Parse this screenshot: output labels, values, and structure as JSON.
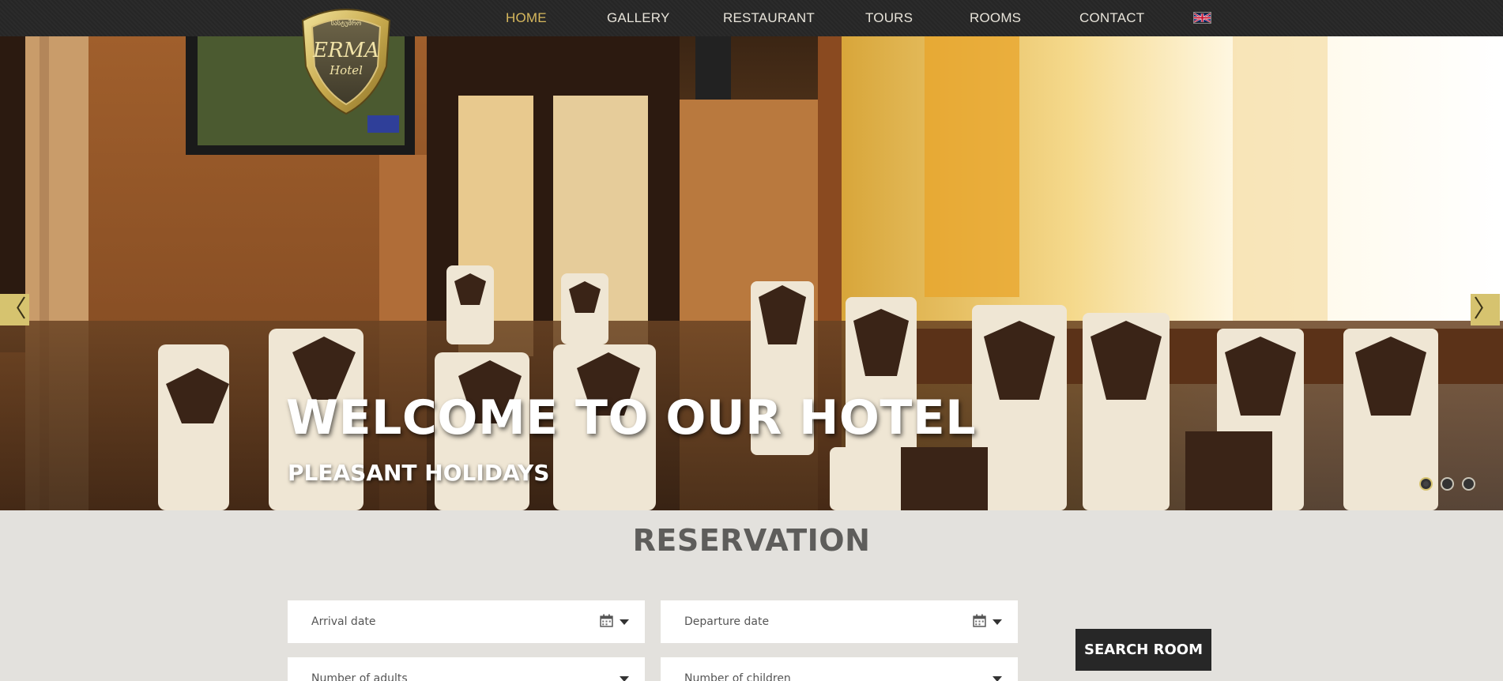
{
  "header": {
    "logo": {
      "top_text": "სასტუმრო",
      "brand": "ERMA",
      "sub": "Hotel"
    },
    "nav": [
      {
        "label": "HOME",
        "active": true
      },
      {
        "label": "GALLERY",
        "active": false
      },
      {
        "label": "RESTAURANT",
        "active": false
      },
      {
        "label": "TOURS",
        "active": false
      },
      {
        "label": "ROOMS",
        "active": false
      },
      {
        "label": "CONTACT",
        "active": false
      }
    ],
    "language_icon": "uk-flag-icon"
  },
  "hero": {
    "title": "WELCOME TO OUR HOTEL",
    "subtitle": "PLEASANT HOLIDAYS",
    "prev_symbol": "〈",
    "next_symbol": "〉",
    "slides_count": 3,
    "active_slide": 1
  },
  "reservation": {
    "title": "RESERVATION",
    "arrival_placeholder": "Arrival date",
    "departure_placeholder": "Departure date",
    "adults_placeholder": "Number of adults",
    "children_placeholder": "Number of children",
    "search_label": "SEARCH ROOM"
  },
  "colors": {
    "accent": "#d7b85d",
    "nav_bg": "#262626",
    "page_bg": "#e3e1dd",
    "button_bg": "#272727"
  }
}
